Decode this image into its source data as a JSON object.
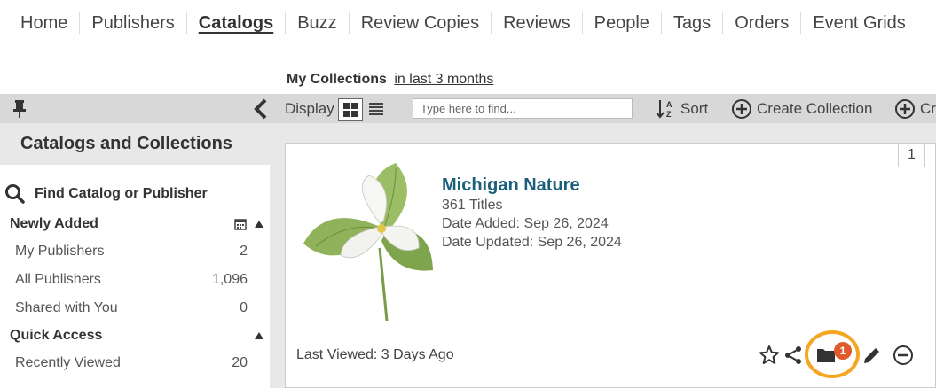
{
  "nav": {
    "items": [
      "Home",
      "Publishers",
      "Catalogs",
      "Buzz",
      "Review Copies",
      "Reviews",
      "People",
      "Tags",
      "Orders",
      "Event Grids"
    ],
    "active_index": 2
  },
  "collections_header": {
    "title": "My Collections",
    "range": "in last 3 months"
  },
  "toolbar": {
    "display_label": "Display",
    "find_placeholder": "Type here to find...",
    "sort_label": "Sort",
    "create_collection_label": "Create Collection",
    "create_partial_label": "Cr"
  },
  "sidebar": {
    "heading": "Catalogs and Collections",
    "find_label": "Find Catalog or Publisher",
    "sections": [
      {
        "title": "Newly Added",
        "rows": [
          {
            "label": "My Publishers",
            "count": "2"
          },
          {
            "label": "All Publishers",
            "count": "1,096"
          },
          {
            "label": "Shared with You",
            "count": "0"
          }
        ]
      },
      {
        "title": "Quick Access",
        "rows": [
          {
            "label": "Recently Viewed",
            "count": "20"
          }
        ]
      }
    ]
  },
  "card": {
    "number": "1",
    "title": "Michigan Nature",
    "titles": "361 Titles",
    "date_added": "Date Added: Sep 26, 2024",
    "date_updated": "Date Updated: Sep 26, 2024",
    "last_viewed": "Last Viewed: 3 Days Ago",
    "folder_badge": "1"
  },
  "colors": {
    "accent_title": "#1b5f7a",
    "highlight": "#f5a623",
    "badge": "#e05a2b",
    "toolbar_bg": "#d8d8d8"
  }
}
